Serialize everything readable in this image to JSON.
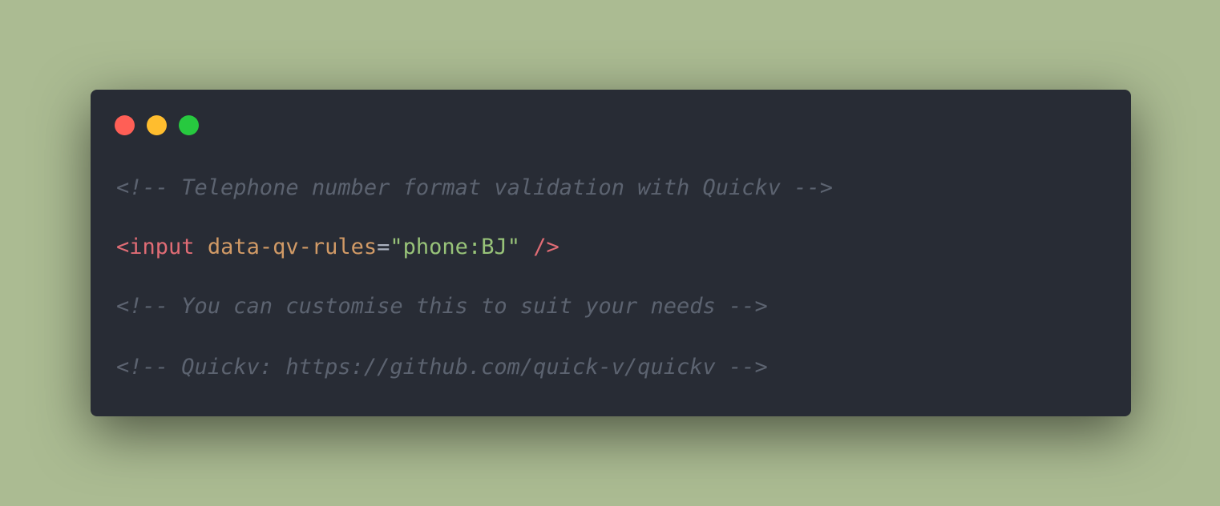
{
  "colors": {
    "background": "#abbb92",
    "window": "#282c35",
    "comment": "#5c6370",
    "tag": "#e06c75",
    "attribute": "#d19a66",
    "punctuation": "#abb2bf",
    "string": "#98c379",
    "close_dot": "#ff5f56",
    "minimize_dot": "#ffbd2e",
    "zoom_dot": "#27c93f"
  },
  "window_controls": [
    "close-dot",
    "minimize-dot",
    "zoom-dot"
  ],
  "code": {
    "comment_title": "<!-- Telephone number format validation with Quickv -->",
    "tag_open": "<input",
    "attr_name": "data-qv-rules",
    "equals": "=",
    "attr_value": "\"phone:BJ\"",
    "tag_close": "/>",
    "comment_customise": "<!-- You can customise this to suit your needs -->",
    "comment_link": "<!-- Quickv: https://github.com/quick-v/quickv -->"
  }
}
